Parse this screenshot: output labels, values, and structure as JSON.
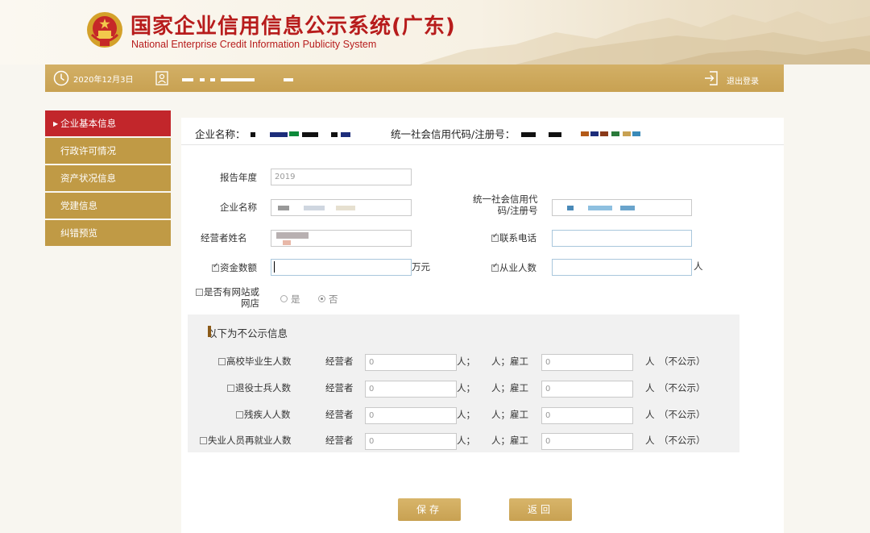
{
  "header": {
    "title_cn": "国家企业信用信息公示系统(广东)",
    "title_en": "National Enterprise Credit Information Publicity System"
  },
  "toolbar": {
    "date": "2020年12月3日",
    "logout_label": "退出登录"
  },
  "sidebar": {
    "items": [
      {
        "label": "企业基本信息",
        "active": true
      },
      {
        "label": "行政许可情况",
        "active": false
      },
      {
        "label": "资产状况信息",
        "active": false
      },
      {
        "label": "党建信息",
        "active": false
      },
      {
        "label": "纠错预览",
        "active": false
      }
    ]
  },
  "info_bar": {
    "company_name_label": "企业名称：",
    "credit_code_label": "统一社会信用代码/注册号："
  },
  "form": {
    "report_year_label": "报告年度",
    "report_year_value": "2019",
    "company_name_label": "企业名称",
    "credit_code_label_line1": "统一社会信用代",
    "credit_code_label_line2": "码/注册号",
    "operator_name_label": "经营者姓名",
    "phone_label": "联系电话",
    "capital_label": "资金数额",
    "capital_unit": "万元",
    "employees_label": "从业人数",
    "employees_unit": "人",
    "website_label_line1": "是否有网站或",
    "website_label_line2": "网店",
    "website_yes": "是",
    "website_no": "否"
  },
  "private_section": {
    "title": "以下为不公示信息",
    "operator_label": "经营者",
    "unit_person_semicolon": "人；",
    "employee_label": "人；雇工",
    "unit_person": "人",
    "not_public": "（不公示）",
    "placeholder": "0",
    "rows": [
      {
        "label": "高校毕业生人数"
      },
      {
        "label": "退役士兵人数"
      },
      {
        "label": "残疾人人数"
      },
      {
        "label": "失业人员再就业人数"
      }
    ]
  },
  "buttons": {
    "save": "保存",
    "back": "返回"
  },
  "colors": {
    "brand_red": "#b71c1c",
    "gold": "#c8a152",
    "active_red": "#c2262b"
  }
}
